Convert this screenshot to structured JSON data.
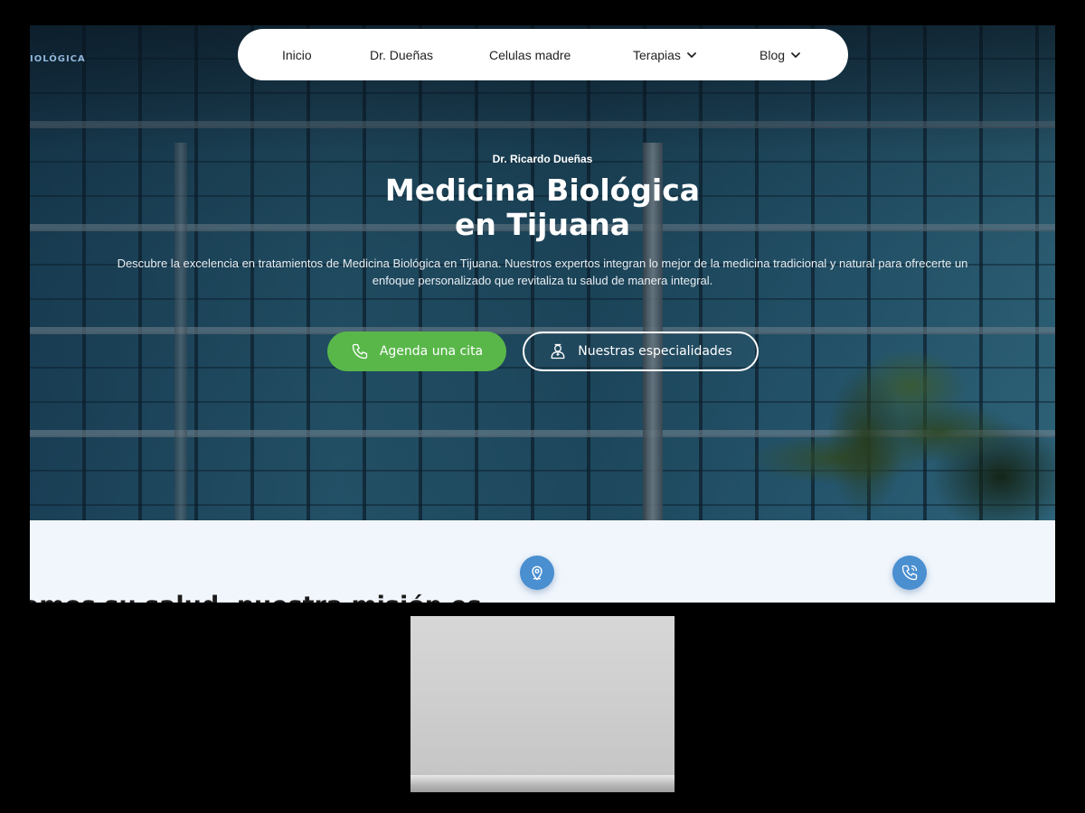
{
  "brand": {
    "fragment": "IOLÓGICA"
  },
  "nav": {
    "items": [
      {
        "label": "Inicio",
        "has_dropdown": false
      },
      {
        "label": "Dr. Dueñas",
        "has_dropdown": false
      },
      {
        "label": "Celulas madre",
        "has_dropdown": false
      },
      {
        "label": "Terapias",
        "has_dropdown": true
      },
      {
        "label": "Blog",
        "has_dropdown": true
      }
    ]
  },
  "hero": {
    "eyebrow": "Dr. Ricardo Dueñas",
    "title": "Medicina Biológica en Tijuana",
    "description": "Descubre la excelencia en tratamientos de Medicina Biológica en Tijuana. Nuestros expertos integran lo mejor de la medicina tradicional y natural para ofrecerte un enfoque personalizado que revitaliza tu salud de manera integral.",
    "primary_button": {
      "label": "Agenda una cita",
      "icon": "phone-icon",
      "color": "#59b74a"
    },
    "secondary_button": {
      "label": "Nuestras especialidades",
      "icon": "doctor-icon"
    }
  },
  "lower": {
    "heading_fragment": "amos su salud, nuestra misión es",
    "icons": [
      "location-pin-icon",
      "phone-call-icon"
    ],
    "accent": "#4a8fd0"
  }
}
